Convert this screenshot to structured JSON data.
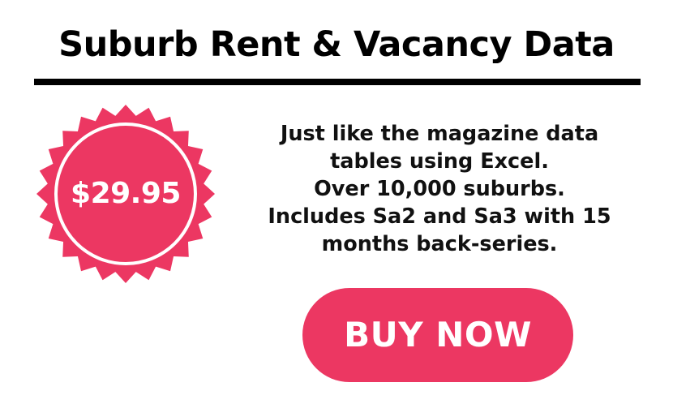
{
  "header": {
    "title": "Suburb Rent & Vacancy Data"
  },
  "badge": {
    "price": "$29.95",
    "color": "#ec3762",
    "icon": "starburst-seal-icon"
  },
  "description": {
    "lines": [
      "Just like the magazine data",
      "tables using Excel.",
      "Over 10,000 suburbs.",
      "Includes Sa2 and Sa3 with 15",
      "months back-series."
    ]
  },
  "cta": {
    "label": "BUY NOW",
    "color": "#ec3762"
  }
}
